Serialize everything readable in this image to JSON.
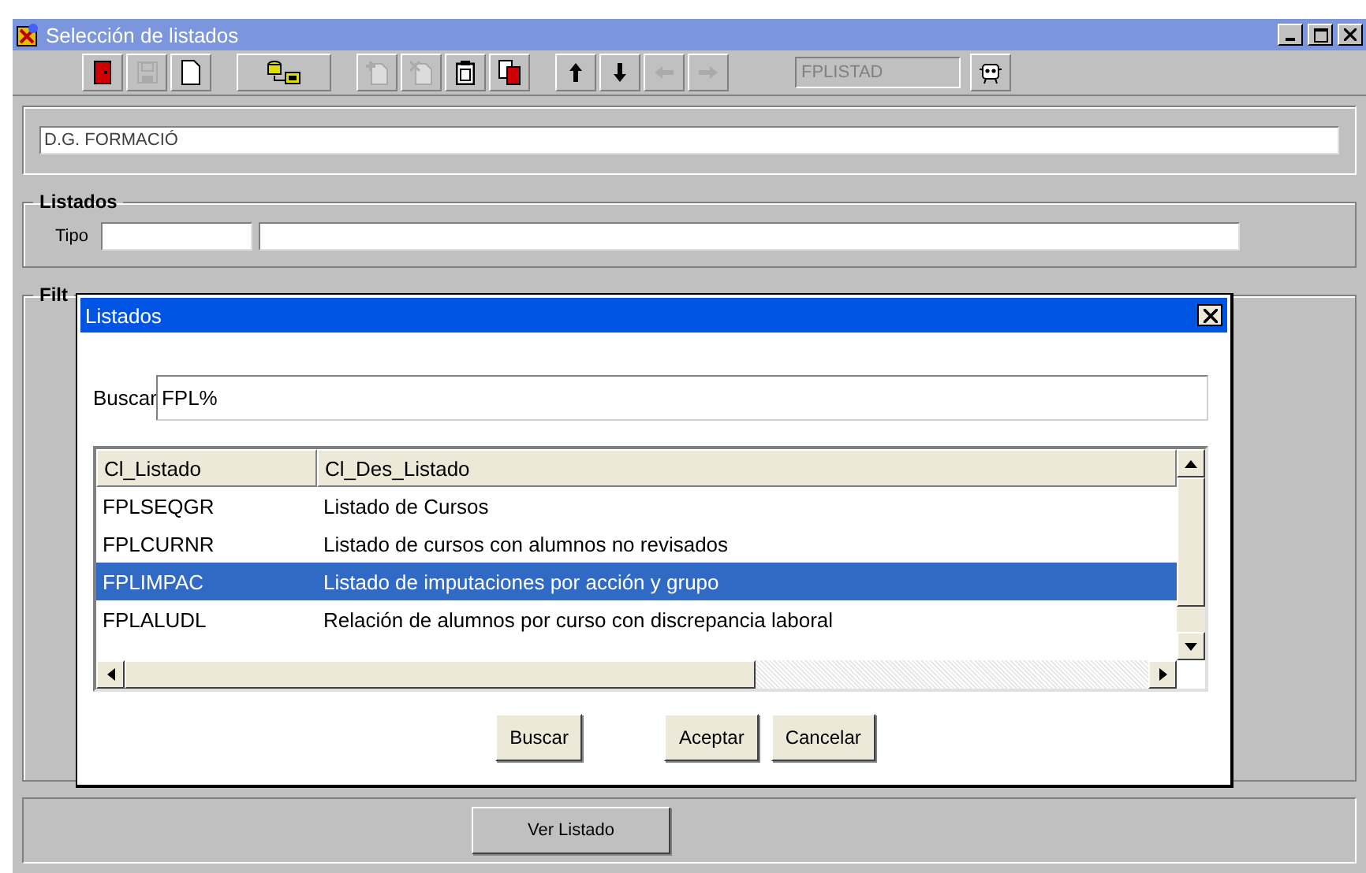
{
  "window": {
    "title": "Selección de listados"
  },
  "toolbar_groups": [
    [
      {
        "kind": "door",
        "disabled": false
      },
      {
        "kind": "disk",
        "disabled": true
      },
      {
        "kind": "page",
        "disabled": false
      }
    ],
    [
      {
        "kind": "database",
        "disabled": false
      }
    ],
    [
      {
        "kind": "doc-plus",
        "disabled": true
      },
      {
        "kind": "doc-cross",
        "disabled": true
      },
      {
        "kind": "clipboard",
        "disabled": false
      },
      {
        "kind": "copy",
        "disabled": false
      }
    ],
    [
      {
        "kind": "up",
        "disabled": false
      },
      {
        "kind": "down",
        "disabled": false
      },
      {
        "kind": "left",
        "disabled": true
      },
      {
        "kind": "right",
        "disabled": true
      }
    ]
  ],
  "form_name": "FPLISTAD",
  "organization": "D.G. FORMACIÓ",
  "listados_group": {
    "title": "Listados",
    "tipo_label": "Tipo"
  },
  "filter_group": {
    "title": "Filt"
  },
  "dialog": {
    "title": "Listados",
    "search_label": "Buscar",
    "search_value": "FPL%",
    "columns": [
      "Cl_Listado",
      "Cl_Des_Listado"
    ],
    "rows": [
      {
        "code": "FPLSEQGR",
        "description": "Listado de Cursos",
        "selected": false
      },
      {
        "code": "FPLCURNR",
        "description": "Listado de cursos con alumnos no revisados",
        "selected": false
      },
      {
        "code": "FPLIMPAC",
        "description": "Listado de imputaciones por acción y grupo",
        "selected": true
      },
      {
        "code": "FPLALUDL",
        "description": "Relación de alumnos por curso con discrepancia laboral",
        "selected": false
      }
    ],
    "buttons": [
      "Buscar",
      "Aceptar",
      "Cancelar"
    ]
  },
  "bottom_button": "Ver Listado"
}
